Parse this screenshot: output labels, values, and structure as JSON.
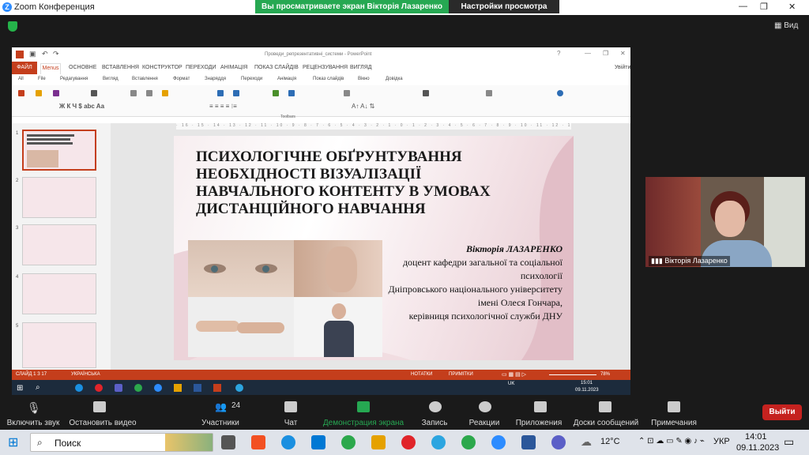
{
  "window": {
    "title": "Zoom Конференция",
    "share_banner": "Вы просматриваете экран Вікторія Лазаренко",
    "view_options": "Настройки просмотра",
    "view_button": "Вид"
  },
  "ppt": {
    "window_title": "Проведи_репрезентативні_системи - PowerPoint",
    "tabs": [
      "ФАЙЛ",
      "Menus",
      "ОСНОВНЕ",
      "ВСТАВЛЕННЯ",
      "КОНСТРУКТОР",
      "ПЕРЕХОДИ",
      "АНІМАЦІЯ",
      "ПОКАЗ СЛАЙДІВ",
      "РЕЦЕНЗУВАННЯ",
      "ВИГЛЯД"
    ],
    "signin": "Увійти",
    "menus": [
      "All",
      "File",
      "Редагування",
      "Вигляд",
      "Вставлення",
      "Формат",
      "Знаряддя",
      "Переходи",
      "Анімація",
      "Показ слайдів",
      "Вікно",
      "Довідка"
    ],
    "toolbars_label": "Toolbars",
    "status_left": "СЛАЙД 1 З 17",
    "status_lang": "УКРАЇНСЬКА",
    "status_notes": "НОТАТКИ",
    "status_comments": "ПРИМІТКИ",
    "zoom_level": "78%",
    "thumb_numbers": [
      "1",
      "2",
      "3",
      "4",
      "5"
    ],
    "ruler": "· 16 · 15 · 14 · 13 · 12 · 11 · 10 · 9 · 8 · 7 · 6 · 5 · 4 · 3 · 2 · 1 · 0 · 1 · 2 · 3 · 4 · 5 · 6 · 7 · 8 · 9 · 10 · 11 · 12 · 13 · 14 · 15 · 16 ·"
  },
  "slide": {
    "title_line1": "Психологічне обґрунтування",
    "title_line2": "необхідності візуалізації",
    "title_line3": "навчального контенту в умовах",
    "title_line4": "дистанційного навчання",
    "author": "Вікторія ЛАЗАРЕНКО",
    "line1": "доцент кафедри загальної та соціальної",
    "line2": "психології",
    "line3": "Дніпровського національного університету",
    "line4": "імені Олеся Гончара,",
    "line5": "керівниця психологічної служби ДНУ"
  },
  "remote_taskbar": {
    "lang": "UK",
    "time": "15:01",
    "date": "09.11.2023"
  },
  "participant": {
    "name": "Вікторія Лазаренко"
  },
  "controls": {
    "unmute": "Включить звук",
    "stop_video": "Остановить видео",
    "participants": "Участники",
    "participants_count": "24",
    "chat": "Чат",
    "share": "Демонстрация экрана",
    "record": "Запись",
    "reactions": "Реакции",
    "apps": "Приложения",
    "whiteboards": "Доски сообщений",
    "notes": "Примечания",
    "leave": "Выйти"
  },
  "taskbar": {
    "search_placeholder": "Поиск",
    "weather": "12°C",
    "lang": "УКР",
    "time": "14:01",
    "date": "09.11.2023"
  },
  "colors": {
    "ppt_accent": "#c43e1c",
    "share_green": "#26a852",
    "zoom_blue": "#2d8cff",
    "leave_red": "#c5221f"
  }
}
